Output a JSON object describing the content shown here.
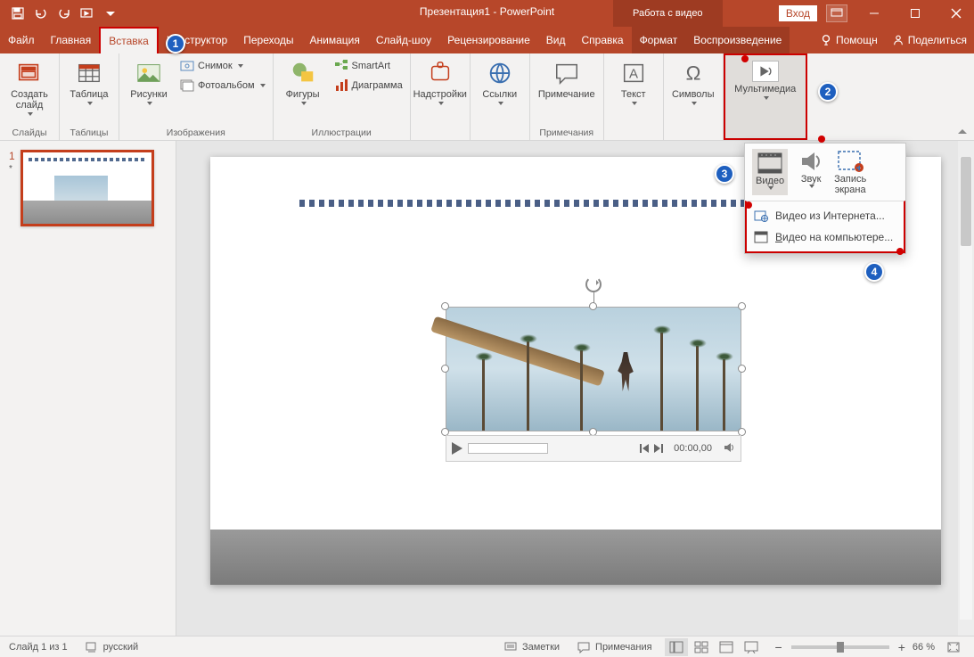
{
  "titlebar": {
    "title": "Презентация1 - PowerPoint",
    "contextual": "Работа с видео",
    "login": "Вход"
  },
  "tabs": {
    "file": "Файл",
    "home": "Главная",
    "insert": "Вставка",
    "design": "Конструктор",
    "transitions": "Переходы",
    "animation": "Анимация",
    "slideshow": "Слайд-шоу",
    "review": "Рецензирование",
    "view": "Вид",
    "help": "Справка",
    "format": "Формат",
    "playback": "Воспроизведение",
    "tell_me": "Помощн",
    "share": "Поделиться"
  },
  "ribbon": {
    "slides": {
      "new_slide": "Создать\nслайд",
      "group": "Слайды"
    },
    "tables": {
      "table": "Таблица",
      "group": "Таблицы"
    },
    "images": {
      "pictures": "Рисунки",
      "screenshot": "Снимок",
      "album": "Фотоальбом",
      "group": "Изображения"
    },
    "illus": {
      "shapes": "Фигуры",
      "smartart": "SmartArt",
      "chart": "Диаграмма",
      "group": "Иллюстрации"
    },
    "addins": {
      "addins": "Надстройки"
    },
    "links": {
      "links": "Ссылки"
    },
    "comments": {
      "comment": "Примечание",
      "group": "Примечания"
    },
    "text": {
      "text": "Текст"
    },
    "symbols": {
      "symbols": "Символы"
    },
    "media": {
      "media": "Мультимедиа"
    }
  },
  "media_dropdown": {
    "video": "Видео",
    "audio": "Звук",
    "screenrec": "Запись\nэкрана",
    "online": "Видео из Интернета...",
    "fromfile": "Видео на компьютере..."
  },
  "player": {
    "time": "00:00,00"
  },
  "thumbs": {
    "num": "1",
    "star": "*"
  },
  "status": {
    "slide_of": "Слайд 1 из 1",
    "lang": "русский",
    "notes": "Заметки",
    "comments": "Примечания",
    "zoom": "66 %"
  },
  "callouts": {
    "c1": "1",
    "c2": "2",
    "c3": "3",
    "c4": "4"
  }
}
